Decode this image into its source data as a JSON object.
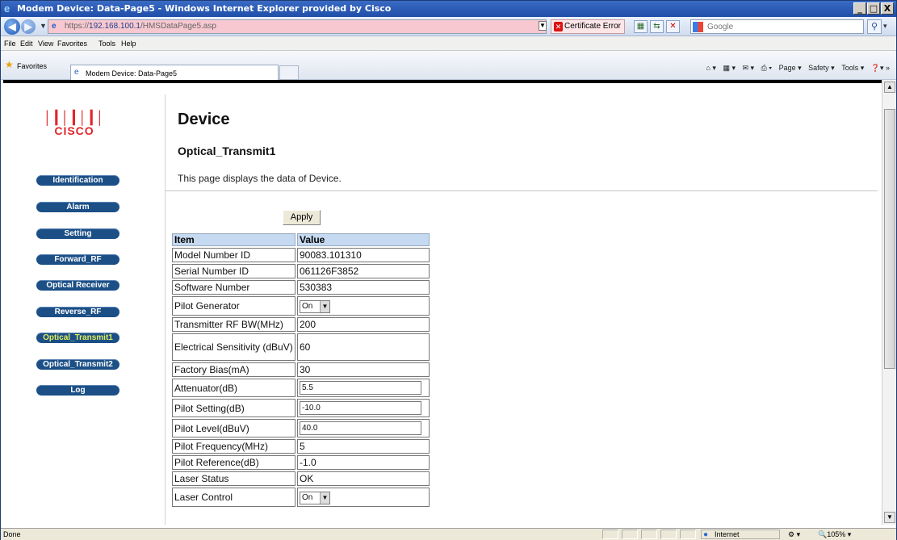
{
  "window": {
    "title": "Modem Device: Data-Page5 - Windows Internet Explorer provided by Cisco",
    "minimize": "_",
    "maximize": "□",
    "close": "X"
  },
  "address": {
    "url_scheme": "https://",
    "url_host": "192.168.100.1",
    "url_path": "/HMSDataPage5.asp",
    "cert_error": "Certificate Error",
    "search_placeholder": "Google"
  },
  "menu": [
    "File",
    "Edit",
    "View",
    "Favorites",
    "Tools",
    "Help"
  ],
  "favorites": {
    "label": "Favorites",
    "tab_title": "Modem Device: Data-Page5",
    "commands": [
      "Page ▾",
      "Safety ▾",
      "Tools ▾"
    ]
  },
  "brand": {
    "bars": "│┃│┃│┃│",
    "name": "CISCO"
  },
  "sidebar": {
    "items": [
      {
        "label": "Identification",
        "active": false
      },
      {
        "label": "Alarm",
        "active": false
      },
      {
        "label": "Setting",
        "active": false
      },
      {
        "label": "Forward_RF",
        "active": false
      },
      {
        "label": "Optical Receiver",
        "active": false
      },
      {
        "label": "Reverse_RF",
        "active": false
      },
      {
        "label": "Optical_Transmit1",
        "active": true
      },
      {
        "label": "Optical_Transmit2",
        "active": false
      },
      {
        "label": "Log",
        "active": false
      }
    ]
  },
  "page": {
    "title": "Device",
    "subtitle": "Optical_Transmit1",
    "description": "This page displays the data of Device.",
    "apply_label": "Apply"
  },
  "table": {
    "headers": [
      "Item",
      "Value"
    ],
    "rows": [
      {
        "item": "Model Number ID",
        "value": "90083.101310",
        "kind": "text"
      },
      {
        "item": "Serial Number ID",
        "value": "061126F3852",
        "kind": "text"
      },
      {
        "item": "Software Number",
        "value": "530383",
        "kind": "text"
      },
      {
        "item": "Pilot Generator",
        "value": "On",
        "kind": "select"
      },
      {
        "item": "Transmitter RF BW(MHz)",
        "value": "200",
        "kind": "text"
      },
      {
        "item": "Electrical Sensitivity (dBuV)",
        "value": "60",
        "kind": "text"
      },
      {
        "item": "Factory Bias(mA)",
        "value": "30",
        "kind": "text"
      },
      {
        "item": "Attenuator(dB)",
        "value": "5.5",
        "kind": "input"
      },
      {
        "item": "Pilot Setting(dB)",
        "value": "-10.0",
        "kind": "input"
      },
      {
        "item": "Pilot Level(dBuV)",
        "value": "40.0",
        "kind": "input"
      },
      {
        "item": "Pilot Frequency(MHz)",
        "value": "5",
        "kind": "text"
      },
      {
        "item": "Pilot Reference(dB)",
        "value": "-1.0",
        "kind": "text"
      },
      {
        "item": "Laser Status",
        "value": "OK",
        "kind": "text"
      },
      {
        "item": "Laser Control",
        "value": "On",
        "kind": "select"
      }
    ]
  },
  "status": {
    "done": "Done",
    "zone": "Internet",
    "zoom": "105%"
  }
}
